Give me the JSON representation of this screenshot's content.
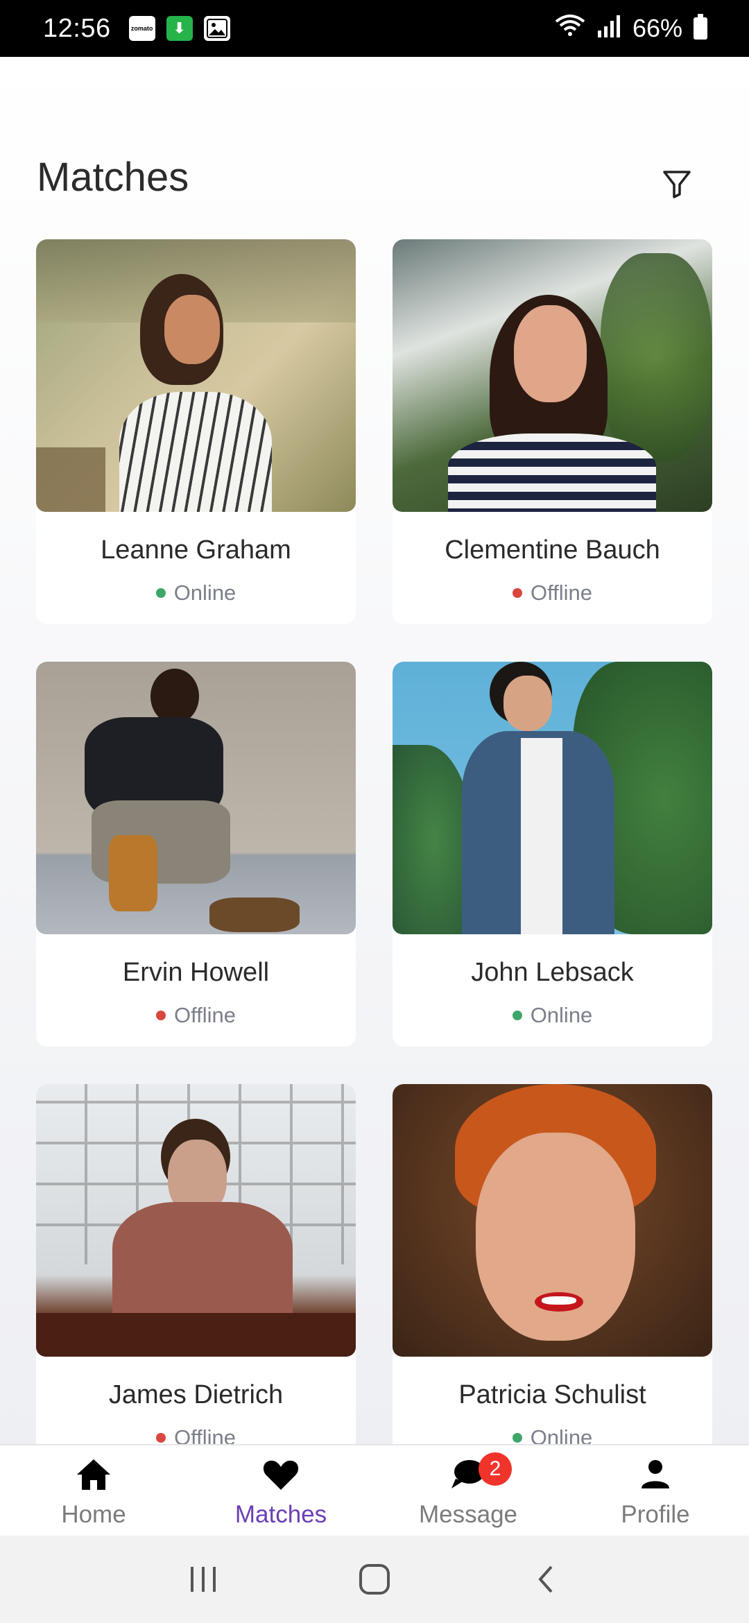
{
  "status_bar": {
    "time": "12:56",
    "notif_zomato": "zomato",
    "battery": "66%"
  },
  "page": {
    "title": "Matches"
  },
  "matches": [
    {
      "name": "Leanne Graham",
      "status": "Online",
      "status_color": "#3fa66b"
    },
    {
      "name": "Clementine Bauch",
      "status": "Offline",
      "status_color": "#d9463e"
    },
    {
      "name": "Ervin Howell",
      "status": "Offline",
      "status_color": "#d9463e"
    },
    {
      "name": "John Lebsack",
      "status": "Online",
      "status_color": "#3fa66b"
    },
    {
      "name": "James Dietrich",
      "status": "Offline",
      "status_color": "#d9463e"
    },
    {
      "name": "Patricia Schulist",
      "status": "Online",
      "status_color": "#3fa66b"
    }
  ],
  "bottom_nav": {
    "home": "Home",
    "matches": "Matches",
    "message": "Message",
    "message_badge": "2",
    "profile": "Profile",
    "active": "Matches",
    "active_color": "#6a3fb5"
  }
}
